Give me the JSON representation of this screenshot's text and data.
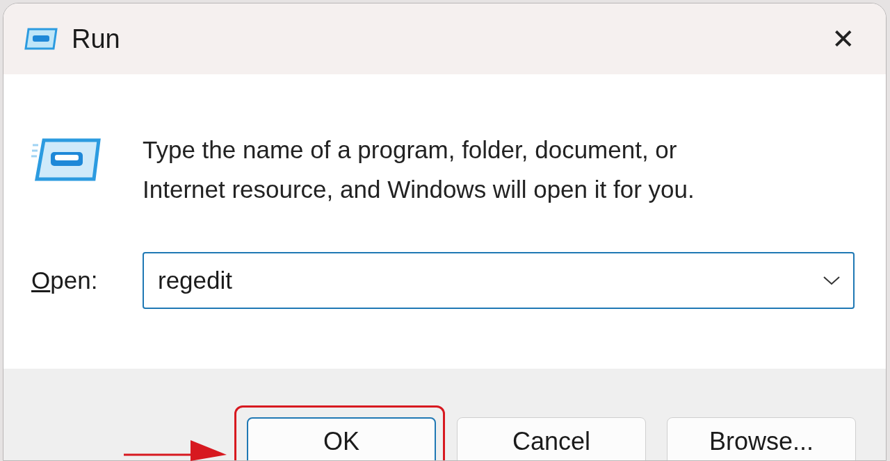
{
  "window": {
    "title": "Run",
    "close": "✕"
  },
  "prompt": "Type the name of a program, folder, document, or\nInternet resource, and Windows will open it for you.",
  "open_field": {
    "label": "Open:",
    "value": "regedit"
  },
  "buttons": [
    {
      "label": "OK",
      "default": true,
      "highlighted": true
    },
    {
      "label": "Cancel",
      "default": false,
      "highlighted": false
    },
    {
      "label": "Browse...",
      "default": false,
      "highlighted": false
    }
  ]
}
